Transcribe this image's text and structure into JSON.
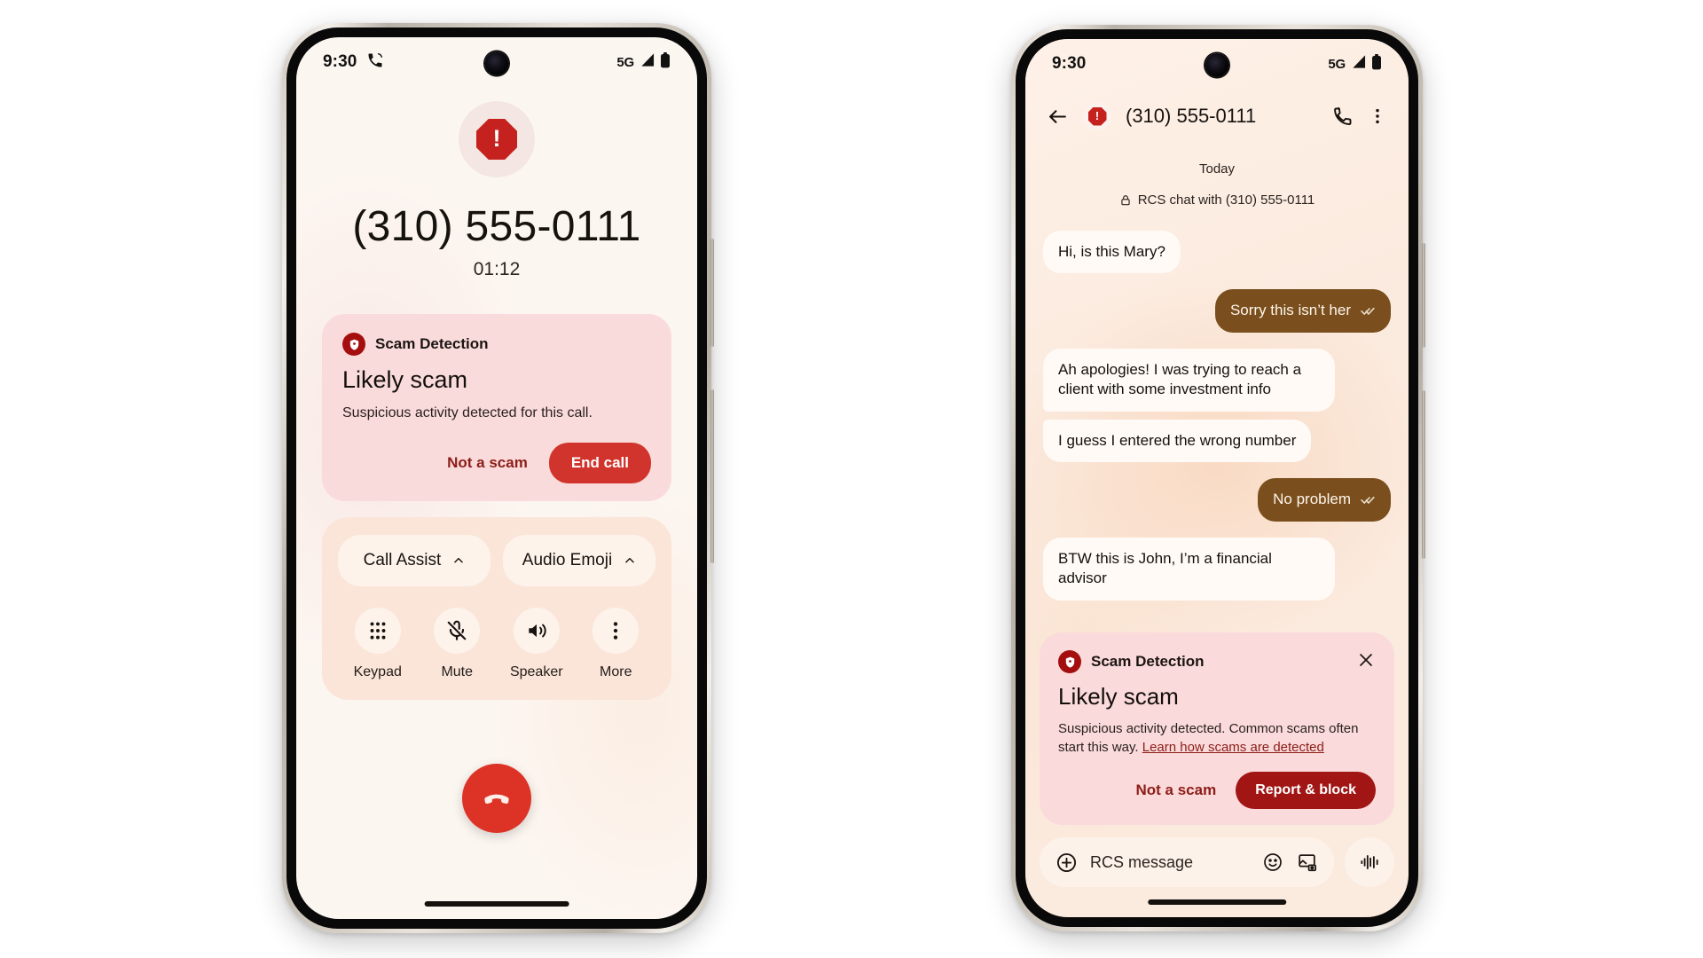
{
  "phone_call": {
    "status_bar": {
      "time": "9:30",
      "network": "5G",
      "call_icon": "phone-in-talk-icon",
      "signal_icon": "signal-bars-icon",
      "battery_icon": "battery-full-icon"
    },
    "caller_number": "(310) 555-0111",
    "call_duration": "01:12",
    "avatar_icon": "scam-octagon-icon",
    "scam_card": {
      "badge_icon": "shield-check-icon",
      "header": "Scam Detection",
      "title": "Likely scam",
      "body": "Suspicious activity detected for this call.",
      "secondary_action": "Not a scam",
      "primary_action": "End call"
    },
    "pills": [
      {
        "label": "Call Assist",
        "icon": "chevron-up-icon"
      },
      {
        "label": "Audio Emoji",
        "icon": "chevron-up-icon"
      }
    ],
    "controls": [
      {
        "label": "Keypad",
        "icon": "dialpad-icon"
      },
      {
        "label": "Mute",
        "icon": "mic-off-icon"
      },
      {
        "label": "Speaker",
        "icon": "volume-up-icon"
      },
      {
        "label": "More",
        "icon": "more-vertical-icon"
      }
    ],
    "end_call_icon": "call-end-icon"
  },
  "phone_messages": {
    "status_bar": {
      "time": "9:30",
      "network": "5G",
      "signal_icon": "signal-bars-icon",
      "battery_icon": "battery-full-icon"
    },
    "app_bar": {
      "back_icon": "arrow-back-icon",
      "avatar_icon": "scam-octagon-icon",
      "title": "(310) 555-0111",
      "call_icon": "phone-icon",
      "overflow_icon": "more-vertical-icon"
    },
    "day_separator": "Today",
    "rcs_note": {
      "icon": "lock-icon",
      "text": "RCS chat with (310) 555-0111"
    },
    "messages": [
      {
        "side": "in",
        "text": "Hi, is this Mary?"
      },
      {
        "side": "out",
        "text": "Sorry this isn’t her",
        "status_icon": "double-check-icon"
      },
      {
        "side": "in",
        "text": "Ah apologies! I was trying to reach a client with some investment info"
      },
      {
        "side": "in",
        "text": "I guess I entered the wrong number"
      },
      {
        "side": "out",
        "text": "No problem",
        "status_icon": "double-check-icon"
      },
      {
        "side": "in",
        "text": "BTW this is John, I’m a financial advisor"
      }
    ],
    "scam_card": {
      "badge_icon": "shield-check-icon",
      "header": "Scam Detection",
      "close_icon": "close-icon",
      "title": "Likely scam",
      "body_prefix": "Suspicious activity detected. Common scams often start this way. ",
      "body_link": "Learn how scams are detected",
      "secondary_action": "Not a scam",
      "primary_action": "Report & block"
    },
    "composer": {
      "add_icon": "plus-circle-icon",
      "placeholder": "RCS message",
      "emoji_icon": "emoji-smile-icon",
      "gallery_icon": "image-icon",
      "mic_icon": "voice-waveform-icon"
    }
  },
  "colors": {
    "scam_red": "#c5221f",
    "end_call_red": "#dd3226",
    "report_block_red": "#a11614",
    "card_pink": "#fadbdb",
    "call_bg": "#fcf6f1",
    "msg_bg": "#fbeade",
    "bubble_out": "#7a4f1d",
    "bubble_in": "#fffaf6"
  }
}
